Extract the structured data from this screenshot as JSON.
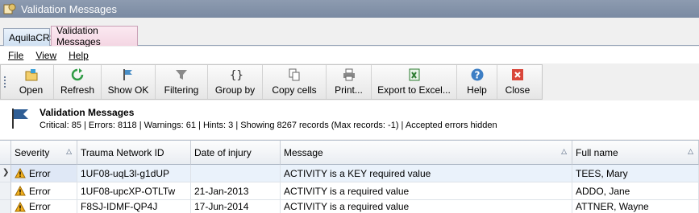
{
  "window": {
    "title": "Validation Messages"
  },
  "tabs": [
    {
      "label": "AquilaCRS"
    },
    {
      "label": "Validation Messages"
    }
  ],
  "menu": {
    "file": "File",
    "view": "View",
    "help": "Help"
  },
  "toolbar": {
    "open": "Open",
    "refresh": "Refresh",
    "show_ok": "Show OK",
    "filtering": "Filtering",
    "group_by": "Group by",
    "copy_cells": "Copy cells",
    "print": "Print...",
    "export": "Export to Excel...",
    "help": "Help",
    "close": "Close"
  },
  "info": {
    "title": "Validation Messages",
    "summary": "Critical: 85 | Errors: 8118 | Warnings: 61 | Hints: 3 | Showing 8267 records (Max records: -1) | Accepted errors hidden"
  },
  "table": {
    "columns": [
      "Severity",
      "Trauma Network ID",
      "Date of injury",
      "Message",
      "Full name"
    ],
    "rows": [
      {
        "severity": "Error",
        "id": "1UF08-uqL3l-g1dUP",
        "date": "",
        "message": "ACTIVITY is a KEY required value",
        "name": "TEES, Mary"
      },
      {
        "severity": "Error",
        "id": "1UF08-upcXP-OTLTw",
        "date": "21-Jan-2013",
        "message": "ACTIVITY is a required value",
        "name": "ADDO, Jane"
      },
      {
        "severity": "Error",
        "id": "F8SJ-IDMF-QP4J",
        "date": "17-Jun-2014",
        "message": "ACTIVITY is a required value",
        "name": "ATTNER, Wayne"
      }
    ]
  },
  "icons": [
    "app-icon",
    "open-icon",
    "refresh-icon",
    "show-ok-icon",
    "filter-icon",
    "group-by-icon",
    "copy-icon",
    "print-icon",
    "excel-icon",
    "help-icon",
    "close-icon",
    "flag-icon",
    "warning-icon",
    "sort-icon"
  ]
}
